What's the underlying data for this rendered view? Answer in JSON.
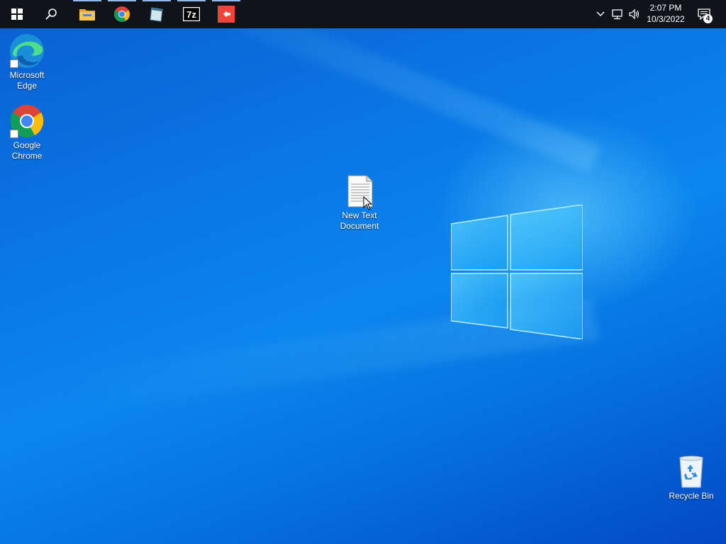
{
  "taskbar": {
    "start_icon": "windows-start-icon",
    "search_icon": "search-icon",
    "pinned": [
      {
        "name": "file-explorer-icon"
      },
      {
        "name": "chrome-icon"
      },
      {
        "name": "notepad-icon"
      },
      {
        "name": "7zip-icon"
      },
      {
        "name": "anydesk-icon"
      }
    ],
    "tray": {
      "chevron_icon": "chevron-up-icon",
      "network_icon": "network-icon",
      "volume_icon": "volume-icon",
      "time": "2:07 PM",
      "date": "10/3/2022",
      "notification_count": "4"
    }
  },
  "desktop": {
    "icons": [
      {
        "label_line1": "Microsoft",
        "label_line2": "Edge"
      },
      {
        "label_line1": "Google",
        "label_line2": "Chrome"
      },
      {
        "label_line1": "New Text",
        "label_line2": "Document"
      },
      {
        "label_line1": "Recycle Bin",
        "label_line2": ""
      }
    ]
  },
  "colors": {
    "taskbar": "#101319",
    "accent": "#0a78e6"
  }
}
